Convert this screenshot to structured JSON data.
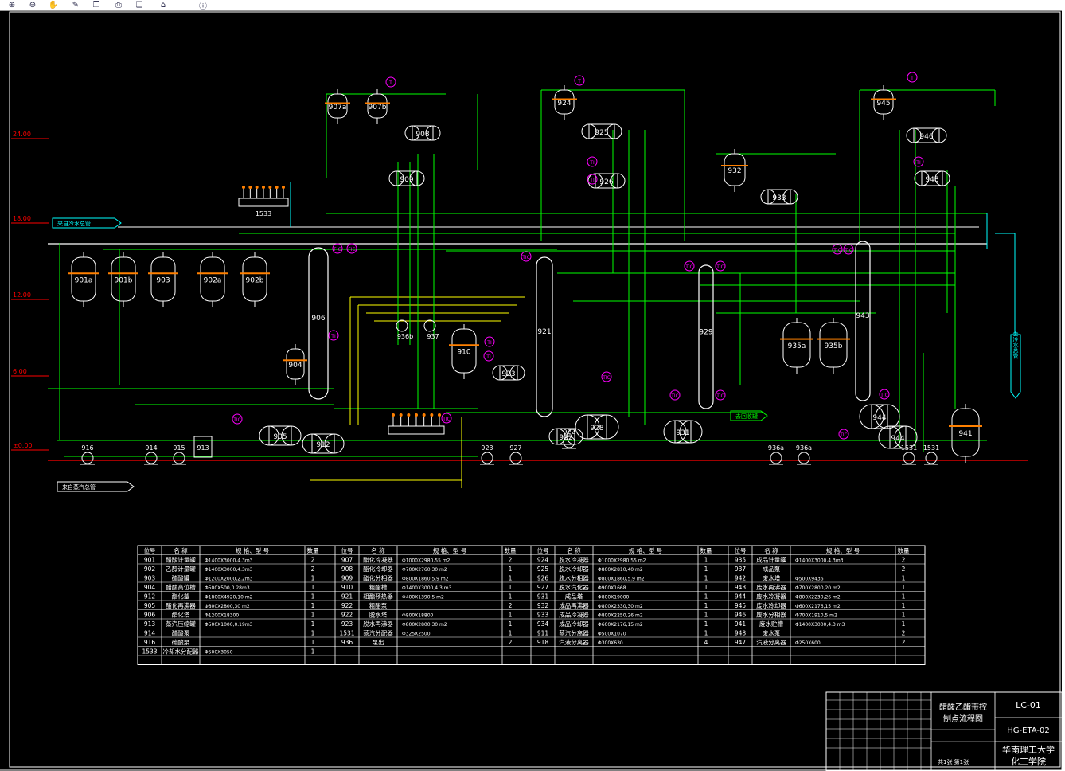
{
  "toolbar": {
    "icons": [
      "zoom-in-icon",
      "zoom-out-icon",
      "pan-icon",
      "pen-icon",
      "copy-icon",
      "print-icon",
      "layers-icon",
      "home-icon",
      "info-icon"
    ]
  },
  "colors": {
    "background": "#000000",
    "pipe_green": "#00ff00",
    "pipe_cyan": "#00ffff",
    "pipe_yellow": "#ffff00",
    "instrument_magenta": "#ff00ff",
    "valve_orange": "#ff8000",
    "ground_red": "#ff0000",
    "equipment_white": "#ffffff"
  },
  "elevations": [
    "24.00",
    "18.00",
    "12.00",
    "6.00",
    "±0.00"
  ],
  "stream_labels": {
    "inlet_top": "来自冷水总管",
    "inlet_bottom": "来自蒸汽总管",
    "outlet_right": "去冷水总管",
    "recycle": "去回收罐"
  },
  "vessels": [
    "901a",
    "901b",
    "903",
    "902a",
    "902b",
    "904",
    "906",
    "905",
    "912",
    "907a",
    "907b",
    "908",
    "909",
    "910",
    "913",
    "914",
    "915",
    "916",
    "921",
    "922",
    "923",
    "924",
    "925",
    "926",
    "927",
    "928",
    "929",
    "931",
    "932",
    "933",
    "934",
    "935a",
    "935b",
    "936a",
    "936b",
    "937",
    "941",
    "942",
    "943",
    "944",
    "945",
    "946",
    "948",
    "1531",
    "1533"
  ],
  "equipment_table": {
    "headers": [
      "位号",
      "名  称",
      "规 格、型 号",
      "数量"
    ],
    "columns": [
      [
        [
          "901",
          "醋酸计量罐",
          "Φ1400X3000,4.3m3",
          "2"
        ],
        [
          "902",
          "乙醇计量罐",
          "Φ1400X3000,4.3m3",
          "2"
        ],
        [
          "903",
          "硫酸罐",
          "Φ1200X2000,2.2m3",
          "1"
        ],
        [
          "904",
          "醋酸高位槽",
          "Φ500X500,0.28m3",
          "1"
        ],
        [
          "912",
          "酯化釜",
          "Φ1800X4920,10 m2",
          "1"
        ],
        [
          "905",
          "酯化再沸器",
          "Φ800X2800,30 m2",
          "1"
        ],
        [
          "906",
          "酯化塔",
          "Φ1200X18300",
          "1"
        ],
        [
          "913",
          "蒸汽压缩罐",
          "Φ500X1000,0.19m3",
          "1"
        ],
        [
          "914",
          "醋酸泵",
          "",
          "1"
        ],
        [
          "916",
          "硫酸泵",
          "",
          "1"
        ],
        [
          "1533",
          "冷却水分配器",
          "Φ500X3050",
          "1"
        ]
      ],
      [
        [
          "907",
          "酯化冷凝器",
          "Φ1000X2980,55 m2",
          "2"
        ],
        [
          "908",
          "酯化冷却器",
          "Φ700X2760,30 m2",
          "1"
        ],
        [
          "909",
          "酯化分相器",
          "Φ800X1860,5.9 m2",
          "1"
        ],
        [
          "910",
          "粗酯槽",
          "Φ1400X3000,4.3 m3",
          "1"
        ],
        [
          "921",
          "粗酯预热器",
          "Φ400X1390,5 m2",
          "1"
        ],
        [
          "922",
          "粗酯泵",
          "",
          "2"
        ],
        [
          "922",
          "脱水塔",
          "Φ800X18800",
          "1"
        ],
        [
          "923",
          "脱水再沸器",
          "Φ800X2800,30 m2",
          "1"
        ],
        [
          "1531",
          "蒸汽分配器",
          "Φ325X2500",
          "1"
        ],
        [
          "936",
          "泵出",
          "",
          "2"
        ]
      ],
      [
        [
          "924",
          "脱水冷凝器",
          "Φ1000X2980,55 m2",
          "1"
        ],
        [
          "925",
          "脱水冷却器",
          "Φ800X2810,40 m2",
          "1"
        ],
        [
          "926",
          "脱水分相器",
          "Φ800X1860,5.9 m2",
          "1"
        ],
        [
          "927",
          "脱水汽化器",
          "Φ900X1668",
          "1"
        ],
        [
          "931",
          "成品塔",
          "Φ800X19000",
          "1"
        ],
        [
          "932",
          "成品再沸器",
          "Φ800X2330,30 m2",
          "1"
        ],
        [
          "933",
          "成品冷凝器",
          "Φ800X2250,26 m2",
          "1"
        ],
        [
          "934",
          "成品冷却器",
          "Φ600X2176,15 m2",
          "1"
        ],
        [
          "911",
          "蒸汽分离器",
          "Φ500X1070",
          "1"
        ],
        [
          "918",
          "汽液分离器",
          "Φ300X630",
          "4"
        ]
      ],
      [
        [
          "935",
          "成品计量罐",
          "Φ1400X3000,4.3m3",
          "2"
        ],
        [
          "937",
          "成品泵",
          "",
          "2"
        ],
        [
          "942",
          "废水塔",
          "Φ500X9436",
          "1"
        ],
        [
          "943",
          "废水再沸器",
          "Φ700X2800,20 m2",
          "1"
        ],
        [
          "944",
          "废水冷凝器",
          "Φ800X2230,26 m2",
          "1"
        ],
        [
          "945",
          "废水冷却器",
          "Φ600X2176,15 m2",
          "1"
        ],
        [
          "946",
          "废水分相器",
          "Φ700X1910,5 m2",
          "1"
        ],
        [
          "941",
          "废水贮槽",
          "Φ1400X3000,4.3 m3",
          "1"
        ],
        [
          "948",
          "废水泵",
          "",
          "2"
        ],
        [
          "947",
          "汽液分离器",
          "Φ250X600",
          "2"
        ]
      ]
    ]
  },
  "title_block": {
    "title_line1": "醋酸乙酯带控",
    "title_line2": "制点流程图",
    "drawing_no": "LC-01",
    "project_no": "HG-ETA-02",
    "school": "华南理工大学",
    "college": "化工学院",
    "sheet": "共1张 第1张"
  }
}
